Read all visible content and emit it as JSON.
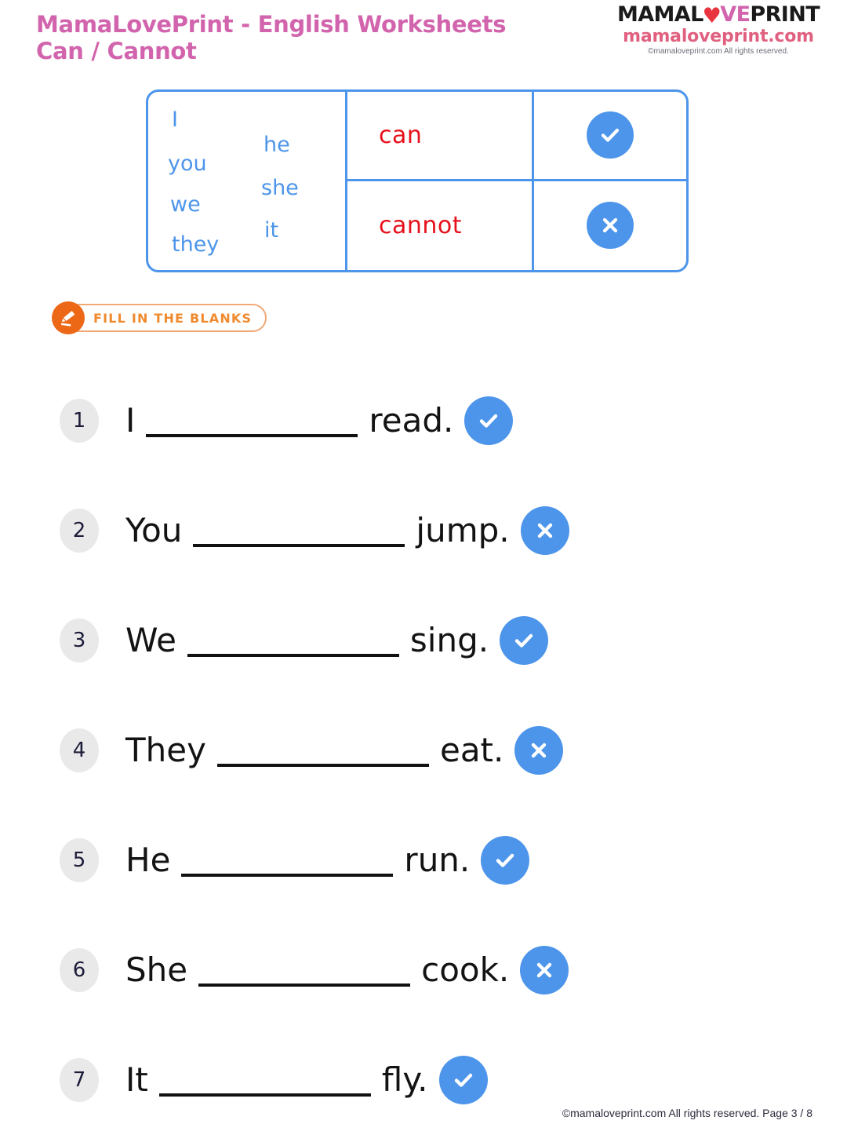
{
  "header": {
    "title_line1": "MamaLovePrint - English Worksheets",
    "title_line2": "Can / Cannot",
    "title_color": "#d264ad",
    "logo": {
      "wordmark_part1": "MAMAL",
      "wordmark_heart": "♥",
      "wordmark_part2": "VE",
      "wordmark_part3": "PRINT",
      "domain": "mamaloveprint.com",
      "rights": "©mamaloveprint.com All rights reserved."
    }
  },
  "pronoun_table": {
    "border_color": "#4d95ea",
    "pronouns_col1": [
      "I",
      "you",
      "we",
      "they"
    ],
    "pronouns_col2": [
      "he",
      "she",
      "it"
    ],
    "rows": [
      {
        "modal": "can",
        "mark": "check-icon"
      },
      {
        "modal": "cannot",
        "mark": "cross-icon"
      }
    ],
    "modal_color": "#e6101b"
  },
  "section_label": {
    "icon": "pencil-icon",
    "text": "FILL IN THE BLANKS",
    "accent_color": "#ec6816"
  },
  "questions": [
    {
      "number": "1",
      "subject": "I",
      "verb": "read.",
      "mark": "check-icon"
    },
    {
      "number": "2",
      "subject": "You",
      "verb": "jump.",
      "mark": "cross-icon"
    },
    {
      "number": "3",
      "subject": "We",
      "verb": "sing.",
      "mark": "check-icon"
    },
    {
      "number": "4",
      "subject": "They",
      "verb": "eat.",
      "mark": "cross-icon"
    },
    {
      "number": "5",
      "subject": "He",
      "verb": "run.",
      "mark": "check-icon"
    },
    {
      "number": "6",
      "subject": "She",
      "verb": "cook.",
      "mark": "cross-icon"
    },
    {
      "number": "7",
      "subject": "It",
      "verb": "fly.",
      "mark": "check-icon"
    }
  ],
  "footer": {
    "text": "©mamaloveprint.com All rights reserved. Page 3 / 8"
  }
}
